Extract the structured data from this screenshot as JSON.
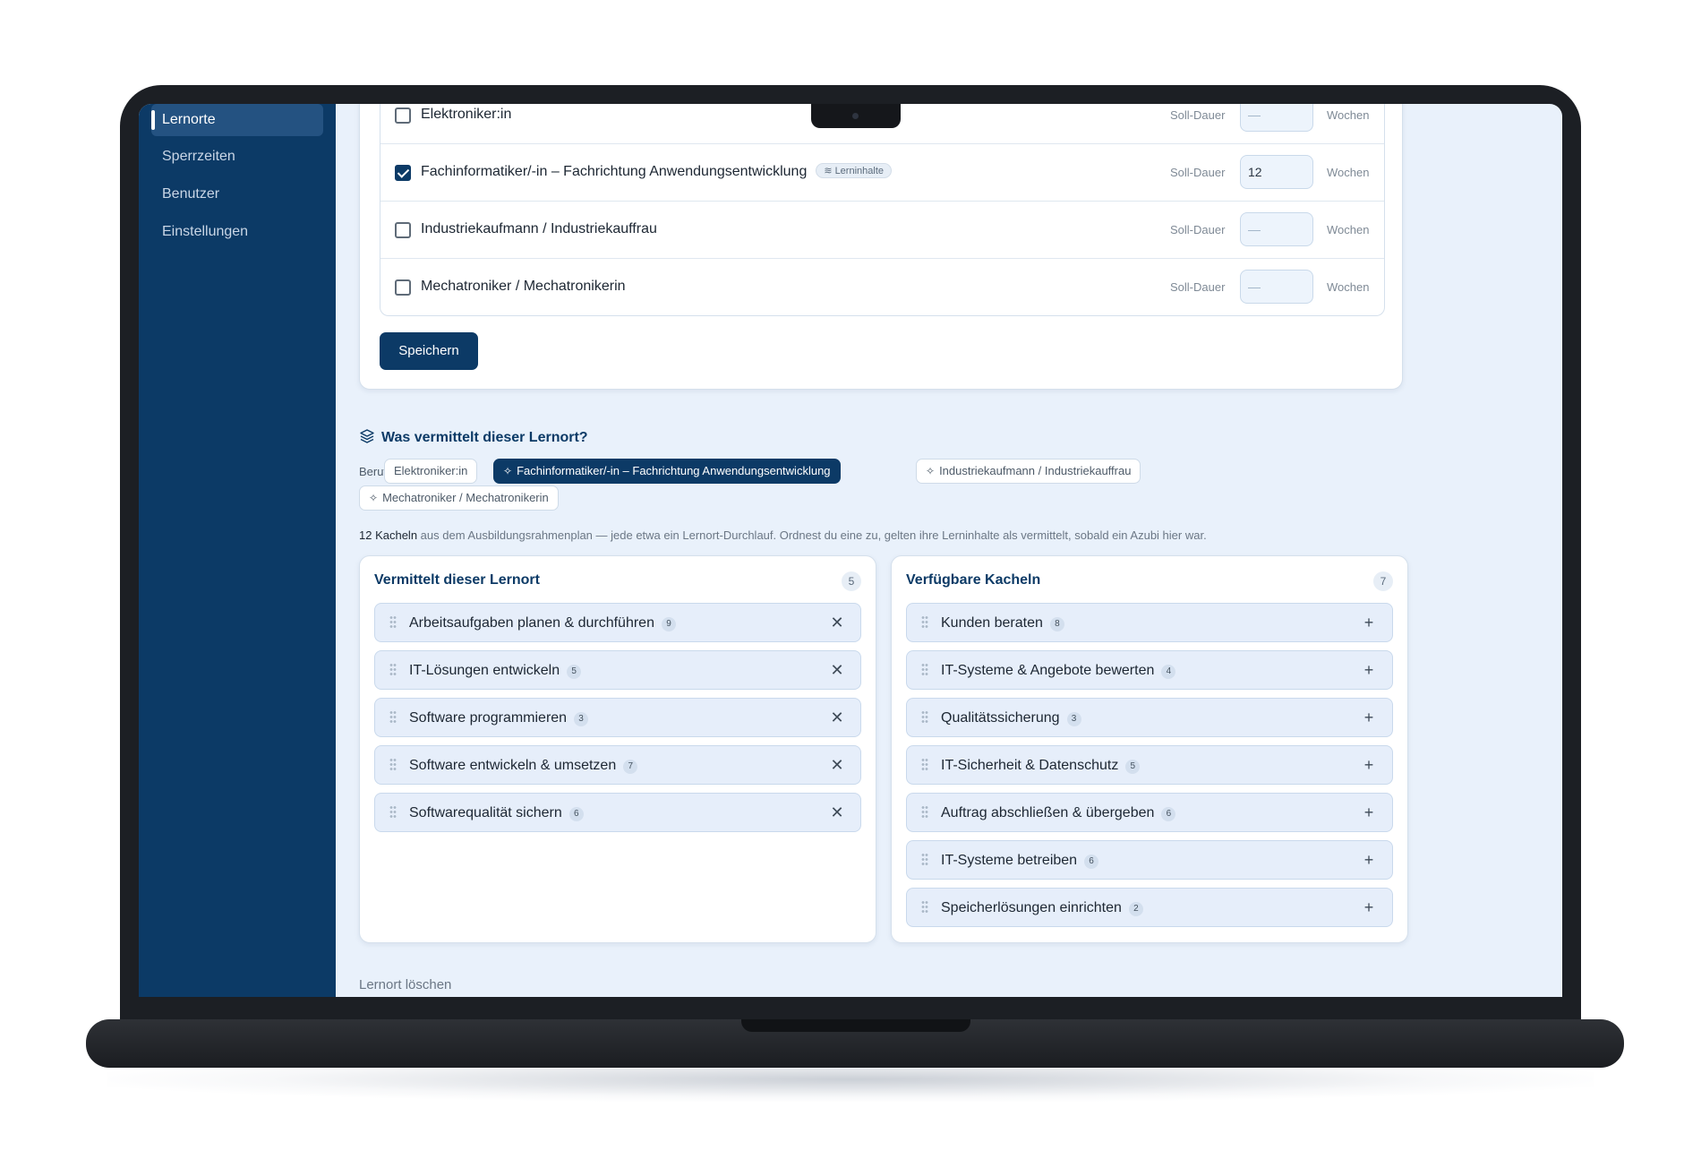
{
  "sidebar": {
    "items": [
      {
        "label": "Lernorte",
        "active": true
      },
      {
        "label": "Sperrzeiten"
      },
      {
        "label": "Benutzer"
      },
      {
        "label": "Einstellungen"
      }
    ]
  },
  "professions": {
    "soll_label": "Soll-Dauer",
    "unit_label": "Wochen",
    "rows": [
      {
        "name": "Elektroniker:in",
        "checked": false,
        "duration": "",
        "placeholder": "—"
      },
      {
        "name": "Fachinformatiker/-in – Fachrichtung Anwendungsentwicklung",
        "checked": true,
        "badge": "Lerninhalte",
        "duration": "12",
        "placeholder": "—"
      },
      {
        "name": "Industriekaufmann / Industriekauffrau",
        "checked": false,
        "duration": "",
        "placeholder": "—"
      },
      {
        "name": "Mechatroniker / Mechatronikerin",
        "checked": false,
        "duration": "",
        "placeholder": "—"
      }
    ],
    "save_label": "Speichern"
  },
  "content_section": {
    "title": "Was vermittelt dieser Lernort?",
    "beruf_label": "Beruf:",
    "chips": [
      {
        "label": "Elektroniker:in",
        "active": false
      },
      {
        "label": "Fachinformatiker/-in – Fachrichtung Anwendungsentwicklung",
        "active": true
      },
      {
        "label": "Industriekaufmann / Industriekauffrau",
        "active": false
      },
      {
        "label": "Mechatroniker / Mechatronikerin",
        "active": false
      }
    ],
    "info_count": "12 Kacheln",
    "info_text": " aus dem Ausbildungsrahmenplan — jede etwa ein Lernort-Durchlauf. Ordnest du eine zu, gelten ihre Lerninhalte als vermittelt, sobald ein Azubi hier war."
  },
  "assigned": {
    "title": "Vermittelt dieser Lernort",
    "count": "5",
    "tiles": [
      {
        "name": "Arbeitsaufgaben planen & durchführen",
        "count": "9"
      },
      {
        "name": "IT-Lösungen entwickeln",
        "count": "5"
      },
      {
        "name": "Software programmieren",
        "count": "3"
      },
      {
        "name": "Software entwickeln & umsetzen",
        "count": "7"
      },
      {
        "name": "Softwarequalität sichern",
        "count": "6"
      }
    ]
  },
  "available": {
    "title": "Verfügbare Kacheln",
    "count": "7",
    "tiles": [
      {
        "name": "Kunden beraten",
        "count": "8"
      },
      {
        "name": "IT-Systeme & Angebote bewerten",
        "count": "4"
      },
      {
        "name": "Qualitätssicherung",
        "count": "3"
      },
      {
        "name": "IT-Sicherheit & Datenschutz",
        "count": "5"
      },
      {
        "name": "Auftrag abschließen & übergeben",
        "count": "6"
      },
      {
        "name": "IT-Systeme betreiben",
        "count": "6"
      },
      {
        "name": "Speicherlösungen einrichten",
        "count": "2"
      }
    ]
  },
  "delete_label": "Lernort löschen",
  "colors": {
    "primary": "#0c3a66",
    "background": "#e9f1fb",
    "tile": "#e6eefa"
  },
  "icons": {
    "remove": "close-icon",
    "add": "plus-icon",
    "drag": "drag-handle-icon",
    "section": "layers-icon",
    "chip": "sparkle-icon"
  }
}
